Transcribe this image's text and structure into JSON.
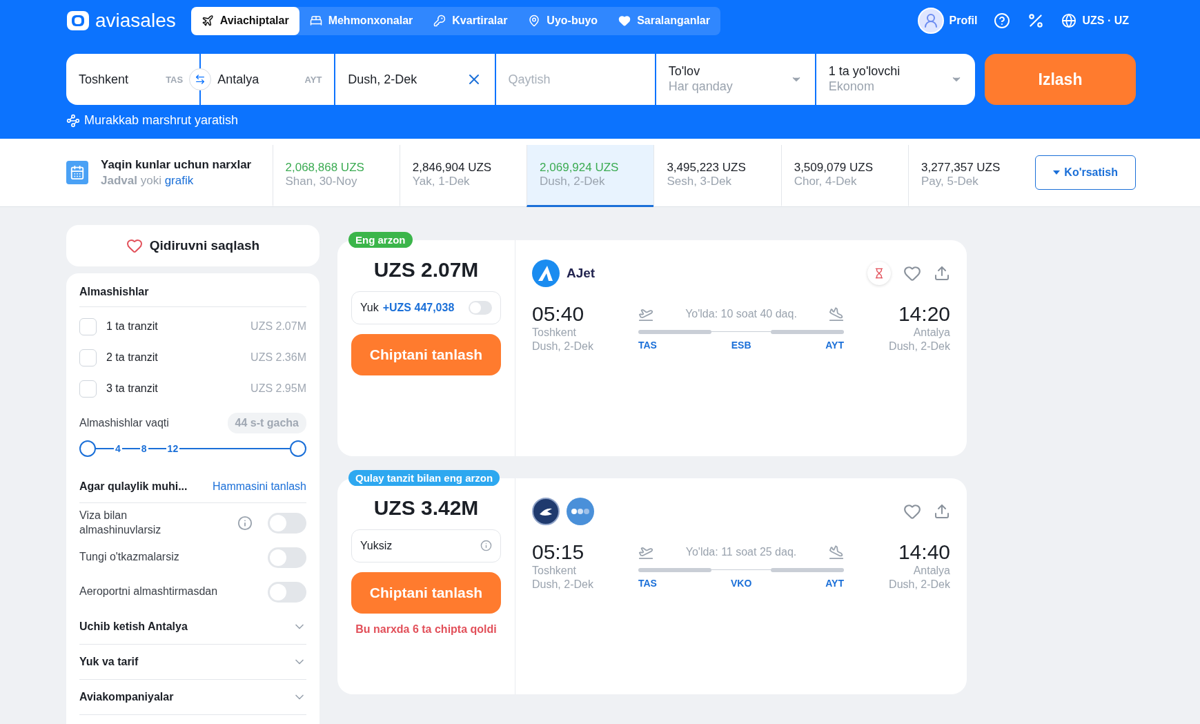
{
  "logo": "aviasales",
  "nav_tabs": [
    {
      "label": "Aviachiptalar",
      "kind": "flights",
      "selected": true
    },
    {
      "label": "Mehmonxonalar",
      "kind": "hotels",
      "selected": false
    },
    {
      "label": "Kvartiralar",
      "kind": "apartments",
      "selected": false
    },
    {
      "label": "Uyo-buyo",
      "kind": "tours",
      "selected": false
    },
    {
      "label": "Saralanganlar",
      "kind": "favorites",
      "selected": false
    }
  ],
  "header_right": {
    "profile": "Profil",
    "locale": "UZS · UZ"
  },
  "search": {
    "origin": {
      "city": "Toshkent",
      "code": "TAS"
    },
    "destination": {
      "city": "Antalya",
      "code": "AYT"
    },
    "depart": "Dush, 2-Dek",
    "return_placeholder": "Qaytish",
    "payment": {
      "label": "To'lov",
      "value": "Har qanday"
    },
    "passengers": {
      "label": "1 ta yo'lovchi",
      "value": "Ekonom"
    },
    "button": "Izlash"
  },
  "complex_route": "Murakkab marshrut yaratish",
  "price_calendar": {
    "title": "Yaqin kunlar uchun narxlar",
    "subtitle": {
      "table": "Jadval",
      "or": "yoki",
      "chart": "grafik"
    },
    "days": [
      {
        "price": "2,068,868 UZS",
        "date": "Shan, 30-Noy",
        "cheap": true,
        "selected": false
      },
      {
        "price": "2,846,904 UZS",
        "date": "Yak, 1-Dek",
        "cheap": false,
        "selected": false
      },
      {
        "price": "2,069,924 UZS",
        "date": "Dush, 2-Dek",
        "cheap": true,
        "selected": true
      },
      {
        "price": "3,495,223 UZS",
        "date": "Sesh, 3-Dek",
        "cheap": false,
        "selected": false
      },
      {
        "price": "3,509,079 UZS",
        "date": "Chor, 4-Dek",
        "cheap": false,
        "selected": false
      },
      {
        "price": "3,277,357 UZS",
        "date": "Pay, 5-Dek",
        "cheap": false,
        "selected": false
      }
    ],
    "button": "Ko'rsatish"
  },
  "sidebar": {
    "save_search": "Qidiruvni saqlash",
    "stops": {
      "title": "Almashishlar",
      "options": [
        {
          "label": "1 ta tranzit",
          "price": "UZS 2.07M",
          "checked": false
        },
        {
          "label": "2 ta tranzit",
          "price": "UZS 2.36M",
          "checked": false
        },
        {
          "label": "3 ta tranzit",
          "price": "UZS 2.95M",
          "checked": false
        }
      ]
    },
    "transfer_time": {
      "label": "Almashishlar vaqti",
      "badge": "44 s-t gacha",
      "ticks": [
        "4",
        "8",
        "12"
      ],
      "thumbs": [
        {
          "level": 0
        },
        {
          "level": 1
        }
      ]
    },
    "comfort": {
      "title": "Agar qulaylik muhi...",
      "link": "Hammasini tanlash",
      "toggles": [
        {
          "label": "Viza bilan almashinuvlarsiz",
          "info": true,
          "on": false
        },
        {
          "label": "Tungi o'tkazmalarsiz",
          "info": false,
          "on": false
        },
        {
          "label": "Aeroportni almashtirmasdan",
          "info": false,
          "on": false
        }
      ]
    },
    "sections": [
      {
        "title": "Uchib ketish Antalya",
        "expanded": false
      },
      {
        "title": "Yuk va tarif",
        "expanded": false
      },
      {
        "title": "Aviakompaniyalar",
        "expanded": false
      }
    ]
  },
  "tickets": [
    {
      "badge": {
        "text": "Eng arzon",
        "color": "#3bb54a"
      },
      "price": "UZS 2.07M",
      "baggage": {
        "kind": "toggle",
        "label": "Yuk",
        "extra": "+UZS 447,038",
        "on": false
      },
      "button": "Chiptani tanlash",
      "airlines": [
        {
          "kind": "ajet",
          "name": "AJet"
        }
      ],
      "hourglass": true,
      "depart": {
        "time": "05:40",
        "city": "Toshkent",
        "date": "Dush, 2-Dek"
      },
      "duration": "Yo'lda: 10 soat 40 daq.",
      "stops": [
        "TAS",
        "ESB",
        "AYT"
      ],
      "arrive": {
        "time": "14:20",
        "city": "Antalya",
        "date": "Dush, 2-Dek"
      }
    },
    {
      "badge": {
        "text": "Qulay tanzit bilan eng arzon",
        "color": "#2ea8f0"
      },
      "price": "UZS 3.42M",
      "baggage": {
        "kind": "info",
        "label": "Yuksiz"
      },
      "button": "Chiptani tanlash",
      "warning": "Bu narxda 6 ta chipta qoldi",
      "airlines": [
        {
          "kind": "emblem"
        },
        {
          "kind": "more"
        }
      ],
      "hourglass": false,
      "depart": {
        "time": "05:15",
        "city": "Toshkent",
        "date": "Dush, 2-Dek"
      },
      "duration": "Yo'lda: 11 soat 25 daq.",
      "stops": [
        "TAS",
        "VKO",
        "AYT"
      ],
      "arrive": {
        "time": "14:40",
        "city": "Antalya",
        "date": "Dush, 2-Dek"
      }
    }
  ]
}
